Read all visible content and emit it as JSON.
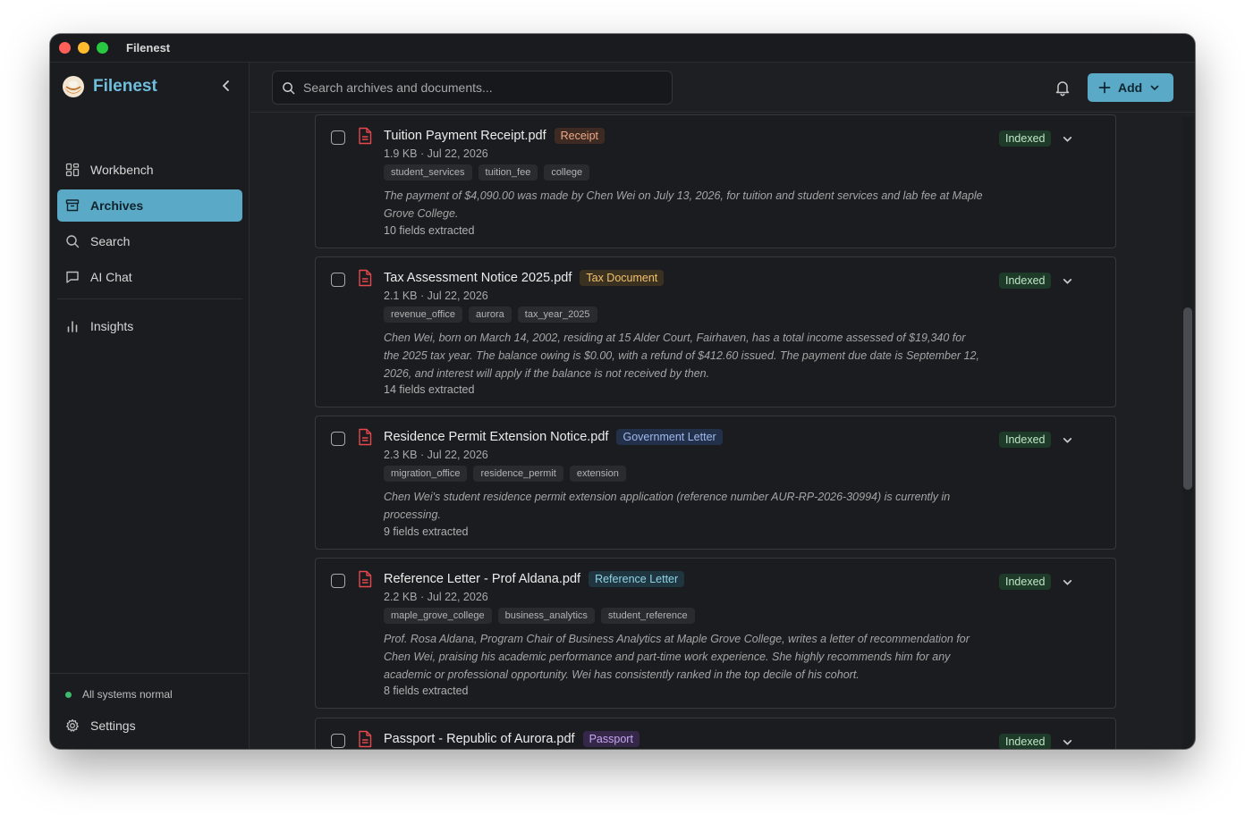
{
  "window": {
    "title": "Filenest"
  },
  "sidebar": {
    "brand": "Filenest",
    "items": [
      {
        "label": "Workbench",
        "icon": "grid-icon"
      },
      {
        "label": "Archives",
        "icon": "archive-icon",
        "active": true
      },
      {
        "label": "Search",
        "icon": "search-icon"
      },
      {
        "label": "AI Chat",
        "icon": "chat-icon"
      }
    ],
    "insights": {
      "label": "Insights",
      "icon": "bar-chart-icon"
    },
    "status": "All systems normal",
    "settings": "Settings"
  },
  "topbar": {
    "search_placeholder": "Search archives and documents...",
    "add_label": "Add"
  },
  "documents": [
    {
      "name": "Tuition Payment Receipt.pdf",
      "type": "Receipt",
      "meta": "1.9 KB · Jul 22, 2026",
      "tags": [
        "student_services",
        "tuition_fee",
        "college"
      ],
      "summary": "The payment of $4,090.00 was made by Chen Wei on July 13, 2026, for tuition and student services and lab fee at Maple Grove College.",
      "fields": "10 fields extracted",
      "status": "Indexed"
    },
    {
      "name": "Tax Assessment Notice 2025.pdf",
      "type": "Tax Document",
      "meta": "2.1 KB · Jul 22, 2026",
      "tags": [
        "revenue_office",
        "aurora",
        "tax_year_2025"
      ],
      "summary": "Chen Wei, born on March 14, 2002, residing at 15 Alder Court, Fairhaven, has a total income assessed of $19,340 for the 2025 tax year. The balance owing is $0.00, with a refund of $412.60 issued. The payment due date is September 12, 2026, and interest will apply if the balance is not received by then.",
      "fields": "14 fields extracted",
      "status": "Indexed"
    },
    {
      "name": "Residence Permit Extension Notice.pdf",
      "type": "Government Letter",
      "meta": "2.3 KB · Jul 22, 2026",
      "tags": [
        "migration_office",
        "residence_permit",
        "extension"
      ],
      "summary": "Chen Wei's student residence permit extension application (reference number AUR-RP-2026-30994) is currently in processing.",
      "fields": "9 fields extracted",
      "status": "Indexed"
    },
    {
      "name": "Reference Letter - Prof Aldana.pdf",
      "type": "Reference Letter",
      "meta": "2.2 KB · Jul 22, 2026",
      "tags": [
        "maple_grove_college",
        "business_analytics",
        "student_reference"
      ],
      "summary": "Prof. Rosa Aldana, Program Chair of Business Analytics at Maple Grove College, writes a letter of recommendation for Chen Wei, praising his academic performance and part-time work experience. She highly recommends him for any academic or professional opportunity. Wei has consistently ranked in the top decile of his cohort.",
      "fields": "8 fields extracted",
      "status": "Indexed"
    },
    {
      "name": "Passport - Republic of Aurora.pdf",
      "type": "Passport",
      "status": "Indexed"
    }
  ]
}
